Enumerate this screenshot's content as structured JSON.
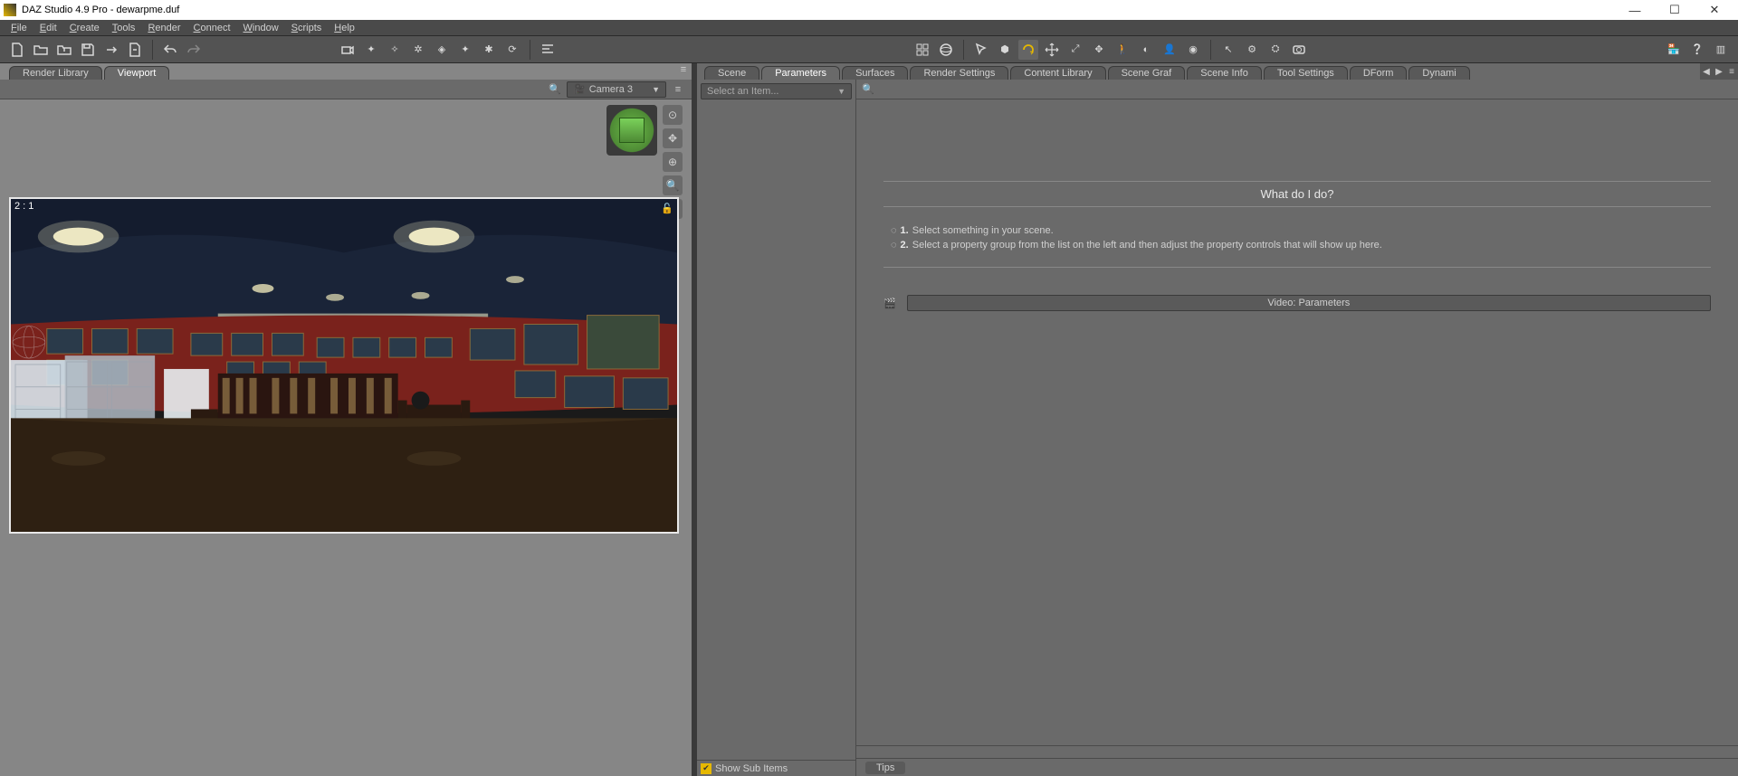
{
  "title": "DAZ Studio 4.9 Pro - dewarpme.duf",
  "menu": [
    "File",
    "Edit",
    "Create",
    "Tools",
    "Render",
    "Connect",
    "Window",
    "Scripts",
    "Help"
  ],
  "left_tabs": [
    {
      "label": "Render Library",
      "active": false
    },
    {
      "label": "Viewport",
      "active": true
    }
  ],
  "camera_selector": {
    "label": "Camera 3"
  },
  "viewport": {
    "ratio": "2 : 1"
  },
  "right_tabs": [
    "Scene",
    "Parameters",
    "Surfaces",
    "Render Settings",
    "Content Library",
    "Scene Graf",
    "Scene Info",
    "Tool Settings",
    "DForm",
    "Dynami"
  ],
  "right_active_tab": "Parameters",
  "item_selector": {
    "placeholder": "Select an Item..."
  },
  "show_sub_items": {
    "label": "Show Sub Items",
    "checked": true
  },
  "help": {
    "header": "What do I do?",
    "step1_n": "1.",
    "step1": "Select something in your scene.",
    "step2_n": "2.",
    "step2": "Select a property group from the list on the left and then adjust the property controls that will show up here."
  },
  "video_button": "Video: Parameters",
  "tips_tab": "Tips"
}
